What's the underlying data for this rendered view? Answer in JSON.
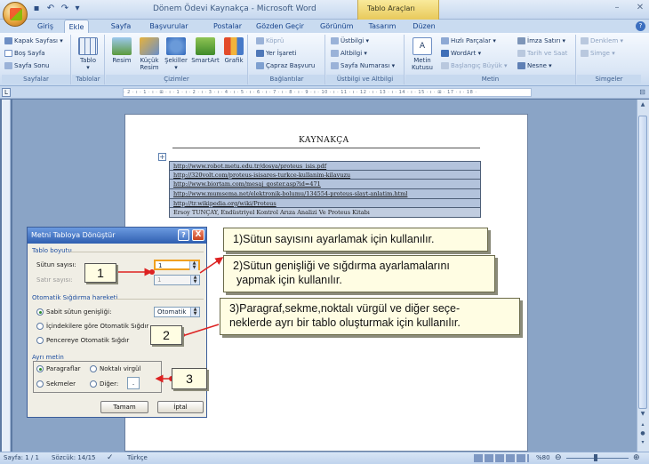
{
  "window": {
    "title": "Dönem Ödevi Kaynakça - Microsoft Word",
    "tool_context_tab": "Tablo Araçları"
  },
  "tabs": [
    "Giriş",
    "Ekle",
    "Sayfa Düzeni",
    "Başvurular",
    "Postalar",
    "Gözden Geçir",
    "Görünüm",
    "Tasarım",
    "Düzen"
  ],
  "active_tab": "Ekle",
  "ribbon": {
    "sayfalar": {
      "label": "Sayfalar",
      "items": [
        "Kapak Sayfası",
        "Boş Sayfa",
        "Sayfa Sonu"
      ]
    },
    "tablolar": {
      "label": "Tablolar",
      "tablo": "Tablo"
    },
    "cizimler": {
      "label": "Çizimler",
      "items": [
        "Resim",
        "Küçük Resim",
        "Şekiller",
        "SmartArt",
        "Grafik"
      ]
    },
    "baglantilar": {
      "label": "Bağlantılar",
      "items": [
        "Köprü",
        "Yer İşareti",
        "Çapraz Başvuru"
      ]
    },
    "ustbilgi": {
      "label": "Üstbilgi ve Altbilgi",
      "items": [
        "Üstbilgi",
        "Altbilgi",
        "Sayfa Numarası"
      ]
    },
    "metin": {
      "label": "Metin",
      "kutusu": "Metin Kutusu",
      "items": [
        "Hızlı Parçalar",
        "WordArt",
        "Başlangıç Büyük",
        "İmza Satırı",
        "Tarih ve Saat",
        "Nesne"
      ]
    },
    "simgeler": {
      "label": "Simgeler",
      "items": [
        "Denklem",
        "Simge"
      ]
    }
  },
  "document": {
    "heading": "KAYNAKÇA",
    "references": [
      "http://www.robot.metu.edu.tr/dosya/proteus_isis.pdf",
      "http://320volt.com/proteus-isisares-turkce-kullanim-kilavuzu",
      "http://www.biortam.com/mesaj_goster.asp?id=471",
      "http://www.mumsema.net/elektronik-bolumu/134554-proteus-slayt-anlatim.html",
      "http://tr.wikipedia.org/wiki/Proteus",
      "Ersoy TUNÇAY, Endüstriyel Kontrol Arıza Analizi Ve Proteus Kitabı"
    ]
  },
  "dialog": {
    "title": "Metni Tabloya Dönüştür",
    "help": "?",
    "close": "X",
    "table_size": "Tablo boyutu",
    "columns_label": "Sütun sayısı:",
    "columns_value": "1",
    "rows_label": "Satır sayısı:",
    "rows_value": "1",
    "autofit": "Otomatik Sığdırma hareketi",
    "fixed_width": "Sabit sütun genişliği:",
    "fixed_width_value": "Otomatik",
    "fit_contents": "İçindekilere göre Otomatik Sığdır",
    "fit_window": "Pencereye Otomatik Sığdır",
    "separate_at": "Ayrı metin",
    "paragraphs": "Paragraflar",
    "semicolons": "Noktalı virgül",
    "tabs": "Sekmeler",
    "other": "Diğer:",
    "other_value": ".",
    "ok": "Tamam",
    "cancel": "İptal"
  },
  "callouts": [
    {
      "num": "1",
      "text": "1)Sütun sayısını ayarlamak için kullanılır."
    },
    {
      "num": "2",
      "text": "2)Sütun genişliği ve sığdırma ayarlamalarını yapmak için kullanılır."
    },
    {
      "num": "3",
      "text": "3)Paragraf,sekme,noktalı vürgül ve diğer seçe-neklerde ayrı bir tablo oluşturmak için kullanılır."
    }
  ],
  "callout_text_lines": {
    "c2a": "2)Sütun genişliği ve sığdırma ayarlamalarını",
    "c2b": "yapmak için kullanılır.",
    "c3a": "3)Paragraf,sekme,noktalı vürgül ve diğer seçe-",
    "c3b": "neklerde ayrı bir tablo oluşturmak için kullanılır."
  },
  "ruler_marks": "· 2 · ı · 1 · ı · ⊞ · ı · 1 · ı · 2 · ı · 3 · ı · 4 · ı · 5 · ı · 6 · ı · 7 · ı · 8 · ı · 9 · ı · 10 · ı · 11 · ı · 12 · ı · 13 · ı · 14 · ı · 15 · ı · ⊞ · 17 · ı · 18 ·",
  "statusbar": {
    "page": "Sayfa: 1 / 1",
    "words": "Sözcük: 14/15",
    "language": "Türkçe",
    "zoom": "%80"
  }
}
